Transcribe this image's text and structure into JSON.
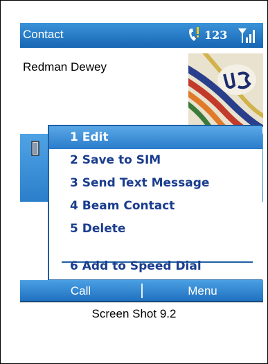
{
  "titlebar": {
    "title": "Contact",
    "mode_indicator": "123",
    "icons": [
      "phone-call-icon",
      "signal-strength-icon"
    ]
  },
  "contact": {
    "name": "Redman Dewey",
    "photo_icon": "contact-photo"
  },
  "menu": {
    "items": [
      {
        "label": "1 Edit",
        "selected": true
      },
      {
        "label": "2 Save to SIM",
        "selected": false
      },
      {
        "label": "3 Send Text Message",
        "selected": false
      },
      {
        "label": "4 Beam Contact",
        "selected": false
      },
      {
        "label": "5 Delete",
        "selected": false
      },
      {
        "label": "6 Add to Speed Dial",
        "selected": false
      }
    ]
  },
  "softkeys": {
    "left": "Call",
    "right": "Menu"
  },
  "caption": "Screen Shot 9.2",
  "colors": {
    "titlebar": "#1f74c4",
    "menu_text": "#1a3d8e",
    "selection": "#3d8fd8"
  }
}
